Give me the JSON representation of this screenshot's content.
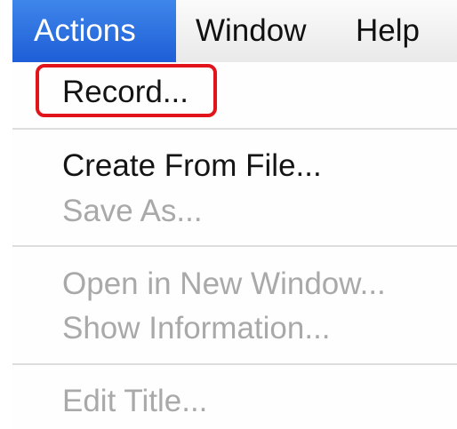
{
  "menubar": {
    "items": [
      {
        "label": "Actions"
      },
      {
        "label": "Window"
      },
      {
        "label": "Help"
      }
    ]
  },
  "menu": {
    "items": [
      {
        "label": "Record...",
        "enabled": true
      },
      {
        "label": "Create From File...",
        "enabled": true
      },
      {
        "label": "Save As...",
        "enabled": false
      },
      {
        "label": "Open in New Window...",
        "enabled": false
      },
      {
        "label": "Show Information...",
        "enabled": false
      },
      {
        "label": "Edit Title...",
        "enabled": false
      }
    ]
  },
  "colors": {
    "active_menu_bg": "#2b6fe0",
    "highlight_box": "#e0141a",
    "disabled_text": "#a9a9a9"
  }
}
